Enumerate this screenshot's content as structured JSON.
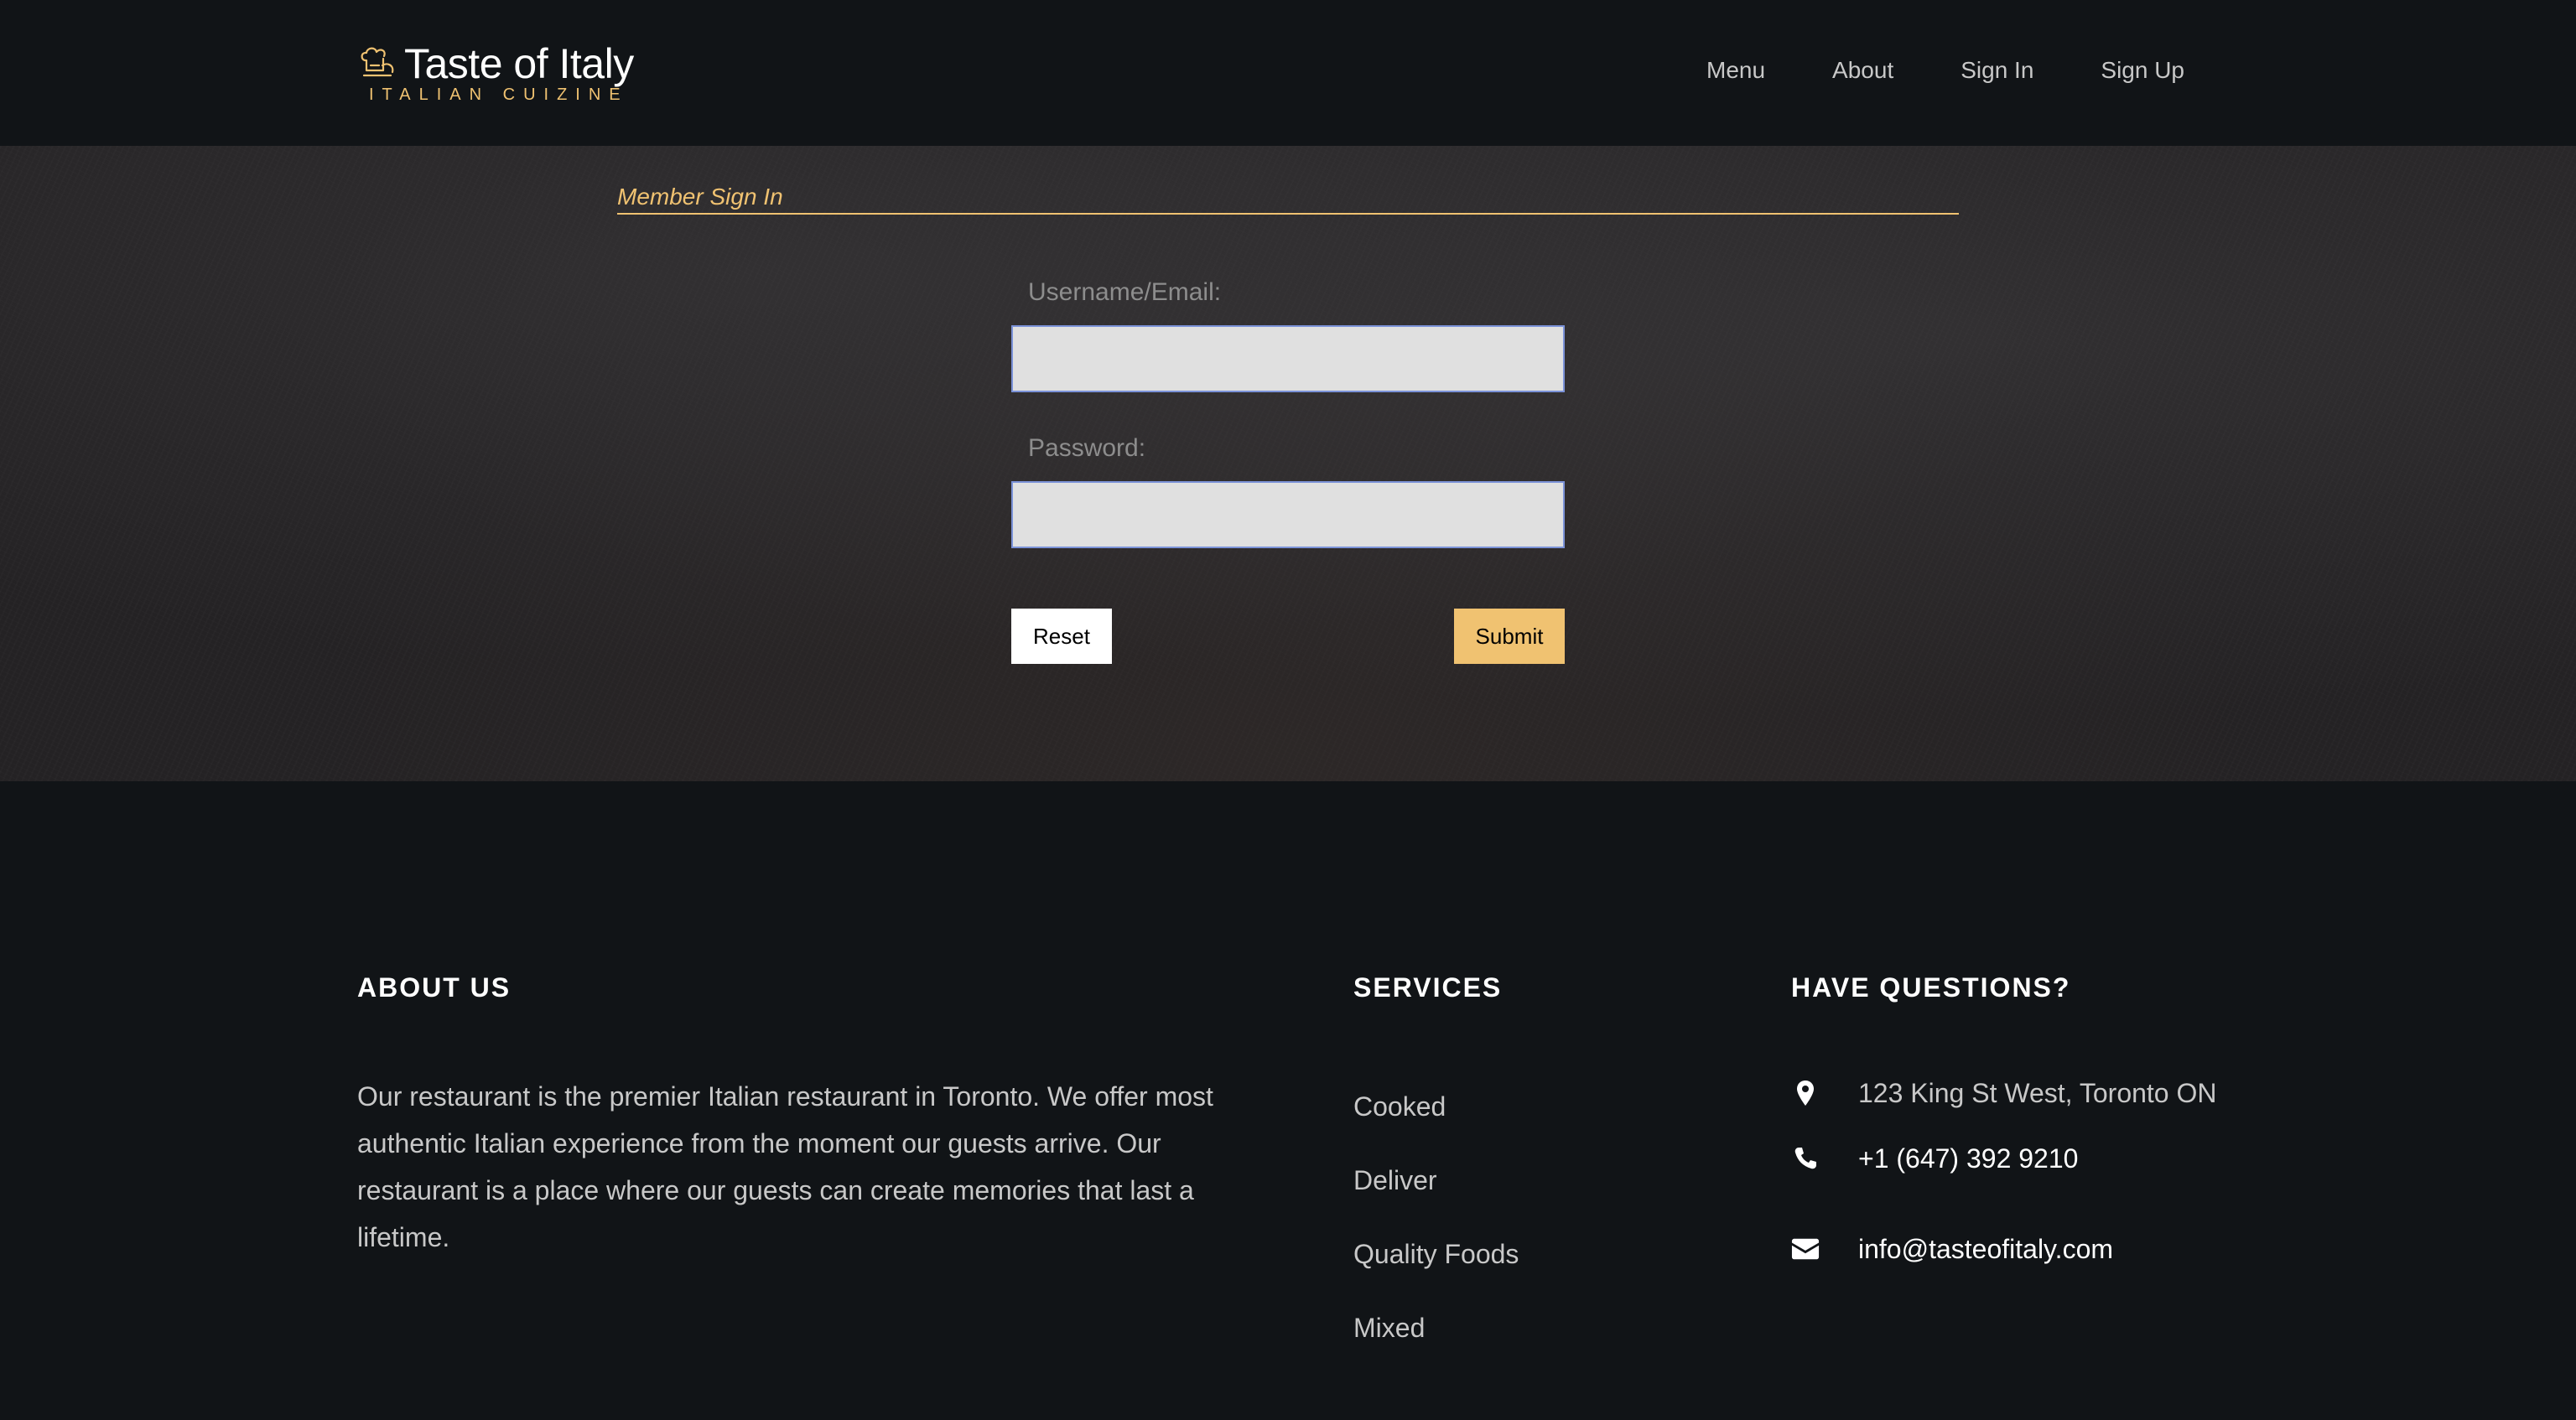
{
  "header": {
    "brand_title": "Taste of Italy",
    "brand_subtitle": "ITALIAN CUIZINE",
    "nav": [
      "Menu",
      "About",
      "Sign In",
      "Sign Up"
    ]
  },
  "signin": {
    "section_title": "Member Sign In",
    "username_label": "Username/Email:",
    "username_value": "",
    "password_label": "Password:",
    "password_value": "",
    "reset_label": "Reset",
    "submit_label": "Submit"
  },
  "footer": {
    "about_heading": "ABOUT US",
    "about_text": "Our restaurant is the premier Italian restaurant in Toronto. We offer most authentic Italian experience from the moment our guests arrive. Our restaurant is a place where our guests can create memories that last a lifetime.",
    "services_heading": "SERVICES",
    "services": [
      "Cooked",
      "Deliver",
      "Quality Foods",
      "Mixed"
    ],
    "questions_heading": "HAVE QUESTIONS?",
    "address": "123 King St West, Toronto ON",
    "phone": "+1 (647) 392 9210",
    "email": "info@tasteofitaly.com"
  },
  "colors": {
    "background": "#111417",
    "accent": "#f0c271",
    "input_bg": "#e0e0e0",
    "input_border": "#7b92d8"
  },
  "icons": {
    "logo": "chef-hat-icon",
    "address": "map-pin-icon",
    "phone": "phone-icon",
    "email": "envelope-icon"
  }
}
